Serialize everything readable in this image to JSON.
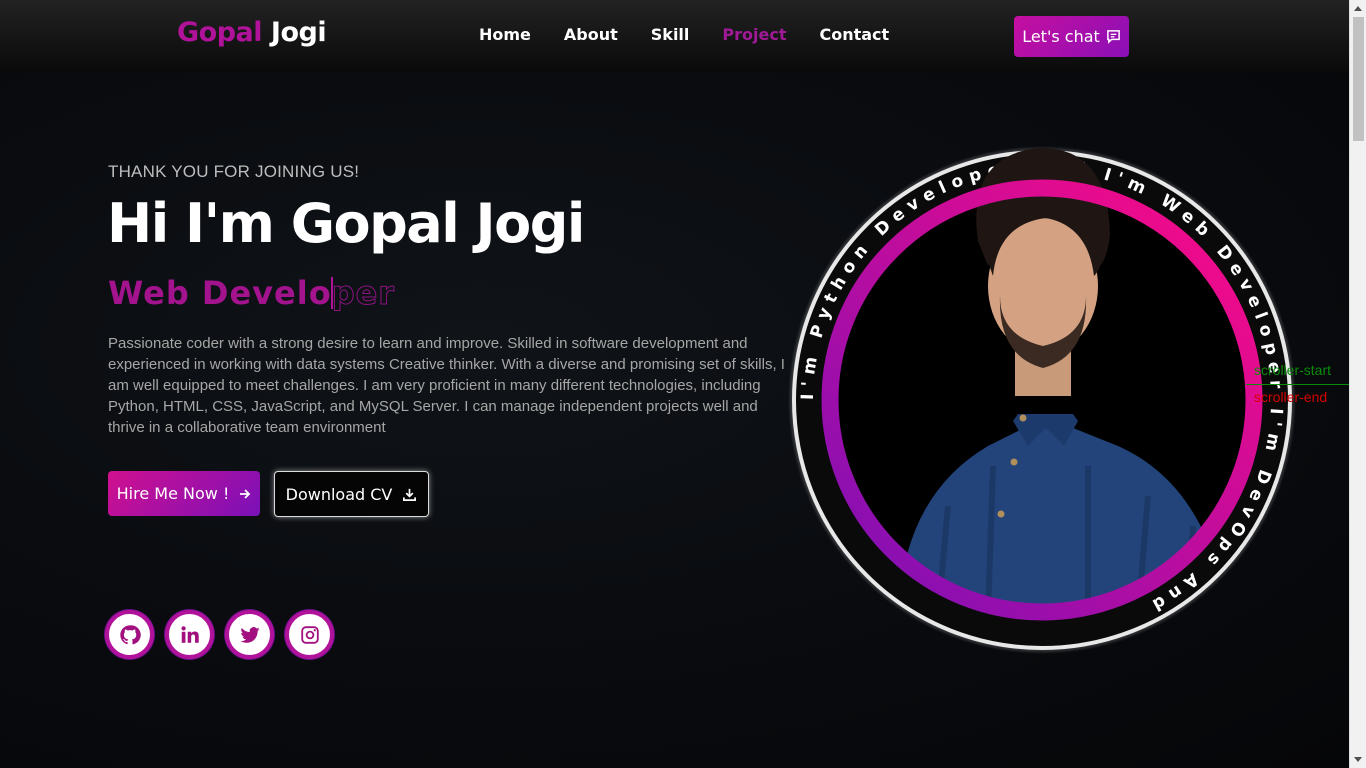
{
  "header": {
    "logo_first": "Gopal",
    "logo_last": "Jogi",
    "nav": [
      "Home",
      "About",
      "Skill",
      "Project",
      "Contact"
    ],
    "active_nav": "Project",
    "chat_label": "Let's chat"
  },
  "hero": {
    "kicker": "THANK YOU FOR JOINING US!",
    "title": "Hi I'm Gopal Jogi",
    "role_typed": "Web Develo",
    "role_remaining": "per",
    "description": "Passionate coder with a strong desire to learn and improve. Skilled in software development and experienced in working with data systems Creative thinker. With a diverse and promising set of skills, I am well equipped to meet challenges. I am very proficient in many different technologies, including Python, HTML, CSS, JavaScript, and MySQL Server. I can manage independent projects well and thrive in a collaborative team environment",
    "hire_label": "Hire Me Now !",
    "cv_label": "Download CV"
  },
  "socials": [
    {
      "name": "github-icon"
    },
    {
      "name": "linkedin-icon"
    },
    {
      "name": "twitter-icon"
    },
    {
      "name": "instagram-icon"
    }
  ],
  "portrait": {
    "ring_text": "I'm Python Developer And I'm Web Developer I'm DevOps And "
  },
  "markers": {
    "start": "scroller-start",
    "end": "scroller-end"
  },
  "colors": {
    "accent": "#b0129a",
    "accent_purple": "#7a10b8",
    "ring_pink": "#ff0a84"
  }
}
